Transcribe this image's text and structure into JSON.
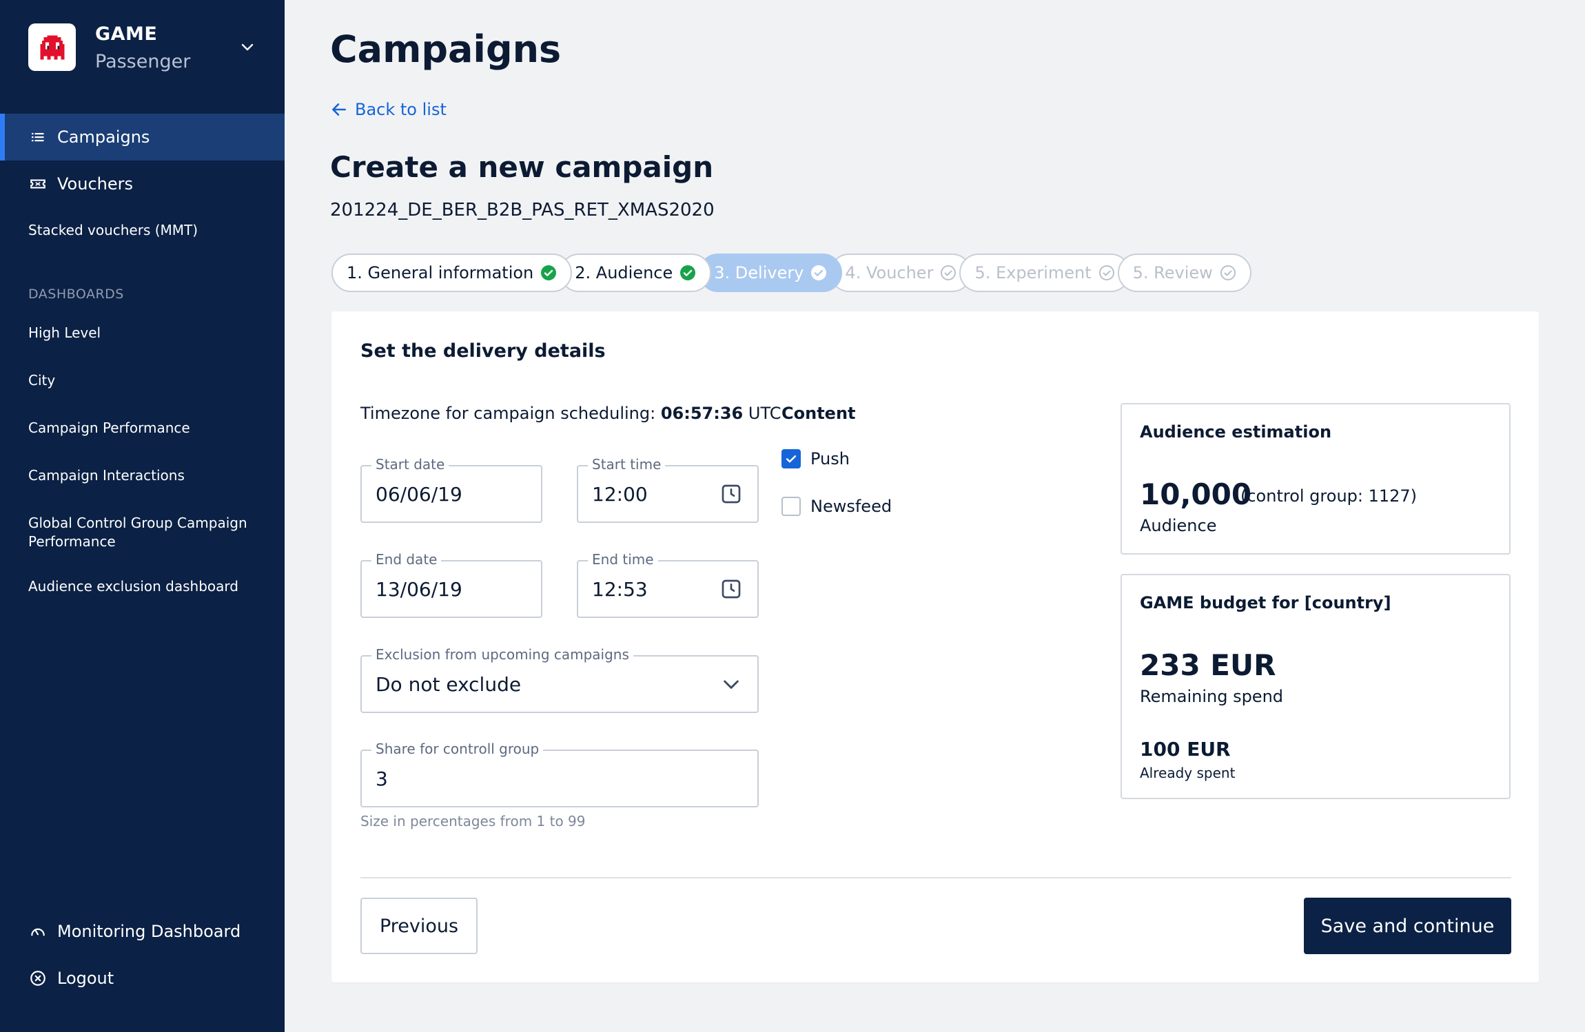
{
  "brand": {
    "title": "GAME",
    "subtitle": "Passenger"
  },
  "nav": {
    "main": [
      {
        "label": "Campaigns",
        "active": true,
        "icon": "list-icon"
      },
      {
        "label": "Vouchers",
        "active": false,
        "icon": "ticket-icon"
      }
    ],
    "sub_item": "Stacked vouchers (MMT)",
    "dashboards_title": "DASHBOARDS",
    "dashboards": [
      "High Level",
      "City",
      "Campaign Performance",
      "Campaign Interactions",
      "Global Control Group Campaign Performance",
      "Audience exclusion dashboard"
    ],
    "bottom": [
      {
        "label": "Monitoring Dashboard",
        "icon": "gauge-icon"
      },
      {
        "label": "Logout",
        "icon": "logout-icon"
      }
    ]
  },
  "page": {
    "title": "Campaigns",
    "back_link": "Back to list",
    "section_title": "Create a new campaign",
    "campaign_code": "201224_DE_BER_B2B_PAS_RET_XMAS2020"
  },
  "stepper": [
    {
      "label": "1. General information",
      "state": "done"
    },
    {
      "label": "2. Audience",
      "state": "done"
    },
    {
      "label": "3. Delivery",
      "state": "current"
    },
    {
      "label": "4. Voucher",
      "state": "todo"
    },
    {
      "label": "5. Experiment",
      "state": "todo"
    },
    {
      "label": "5. Review",
      "state": "todo"
    }
  ],
  "form": {
    "card_title": "Set the delivery details",
    "timezone_prefix": "Timezone for campaign scheduling:",
    "timezone_time": "06:57:36",
    "timezone_suffix": "UTC",
    "start_date": {
      "label": "Start date",
      "value": "06/06/19"
    },
    "start_time": {
      "label": "Start time",
      "value": "12:00"
    },
    "end_date": {
      "label": "End date",
      "value": "13/06/19"
    },
    "end_time": {
      "label": "End time",
      "value": "12:53"
    },
    "exclusion": {
      "label": "Exclusion from upcoming campaigns",
      "value": "Do not exclude"
    },
    "share": {
      "label": "Share for controll group",
      "value": "3",
      "hint": "Size in percentages from 1 to 99"
    }
  },
  "content": {
    "title": "Content",
    "options": [
      {
        "label": "Push",
        "checked": true
      },
      {
        "label": "Newsfeed",
        "checked": false
      }
    ]
  },
  "audience": {
    "title": "Audience estimation",
    "value": "10,000",
    "control": "(control group: 1127)",
    "label": "Audience"
  },
  "budget": {
    "title": "GAME budget for [country]",
    "remaining": "233 EUR",
    "remaining_label": "Remaining spend",
    "spent": "100 EUR",
    "spent_label": "Already spent"
  },
  "actions": {
    "previous": "Previous",
    "save": "Save and continue"
  },
  "colors": {
    "sidebar_bg": "#0b2145",
    "accent": "#1565d8",
    "success": "#17a34a",
    "step_current": "#a9c9f1",
    "brand_red": "#e3102b"
  }
}
